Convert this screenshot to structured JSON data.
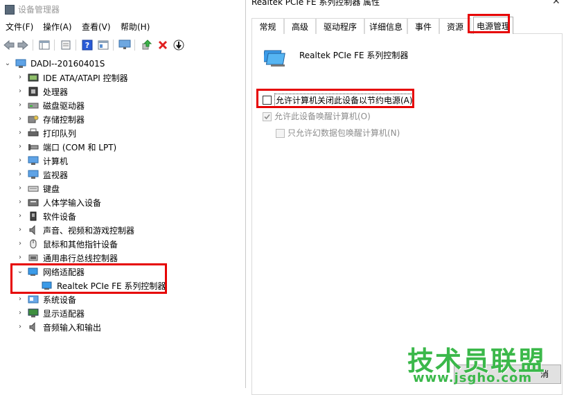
{
  "device_manager": {
    "title": "设备管理器",
    "menu": [
      "文件(F)",
      "操作(A)",
      "查看(V)",
      "帮助(H)"
    ],
    "toolbar_icons": [
      "back-arrow-icon",
      "forward-arrow-icon",
      "properties-grid-icon",
      "show-hidden-icon",
      "help-icon",
      "console-tree-icon",
      "monitor-icon",
      "update-driver-icon",
      "uninstall-x-icon",
      "scan-hardware-icon"
    ],
    "tree": {
      "root": "DADI--20160401S",
      "items": [
        {
          "label": "IDE ATA/ATAPI 控制器",
          "icon": "ide-controller-icon"
        },
        {
          "label": "处理器",
          "icon": "processor-icon"
        },
        {
          "label": "磁盘驱动器",
          "icon": "disk-drive-icon"
        },
        {
          "label": "存储控制器",
          "icon": "storage-controller-icon"
        },
        {
          "label": "打印队列",
          "icon": "printer-icon"
        },
        {
          "label": "端口 (COM 和 LPT)",
          "icon": "port-icon"
        },
        {
          "label": "计算机",
          "icon": "computer-icon"
        },
        {
          "label": "监视器",
          "icon": "monitor-icon"
        },
        {
          "label": "键盘",
          "icon": "keyboard-icon"
        },
        {
          "label": "人体学输入设备",
          "icon": "hid-icon"
        },
        {
          "label": "软件设备",
          "icon": "software-device-icon"
        },
        {
          "label": "声音、视频和游戏控制器",
          "icon": "sound-icon"
        },
        {
          "label": "鼠标和其他指针设备",
          "icon": "mouse-icon"
        },
        {
          "label": "通用串行总线控制器",
          "icon": "usb-icon"
        },
        {
          "label": "网络适配器",
          "icon": "network-adapter-icon",
          "expanded": true
        },
        {
          "label": "Realtek PCIe FE 系列控制器",
          "icon": "network-card-icon",
          "child": true
        },
        {
          "label": "系统设备",
          "icon": "system-device-icon"
        },
        {
          "label": "显示适配器",
          "icon": "display-adapter-icon"
        },
        {
          "label": "音频输入和输出",
          "icon": "audio-io-icon"
        }
      ]
    }
  },
  "properties_dialog": {
    "title": "Realtek PCIe FE 系列控制器 属性",
    "tabs": [
      "常规",
      "高级",
      "驱动程序",
      "详细信息",
      "事件",
      "资源",
      "电源管理"
    ],
    "active_tab": "电源管理",
    "device_name": "Realtek PCIe FE 系列控制器",
    "options": [
      {
        "label": "允许计算机关闭此设备以节约电源(A)",
        "checked": false,
        "enabled": true
      },
      {
        "label": "允许此设备唤醒计算机(O)",
        "checked": true,
        "enabled": false
      },
      {
        "label": "只允许幻数据包唤醒计算机(N)",
        "checked": false,
        "enabled": false
      }
    ],
    "button_partial": "消"
  },
  "watermark": {
    "main": "技术员联盟",
    "url": "www.jsgho.com"
  },
  "colors": {
    "highlight_red": "#e60000",
    "watermark_green": "#3bb84a"
  }
}
